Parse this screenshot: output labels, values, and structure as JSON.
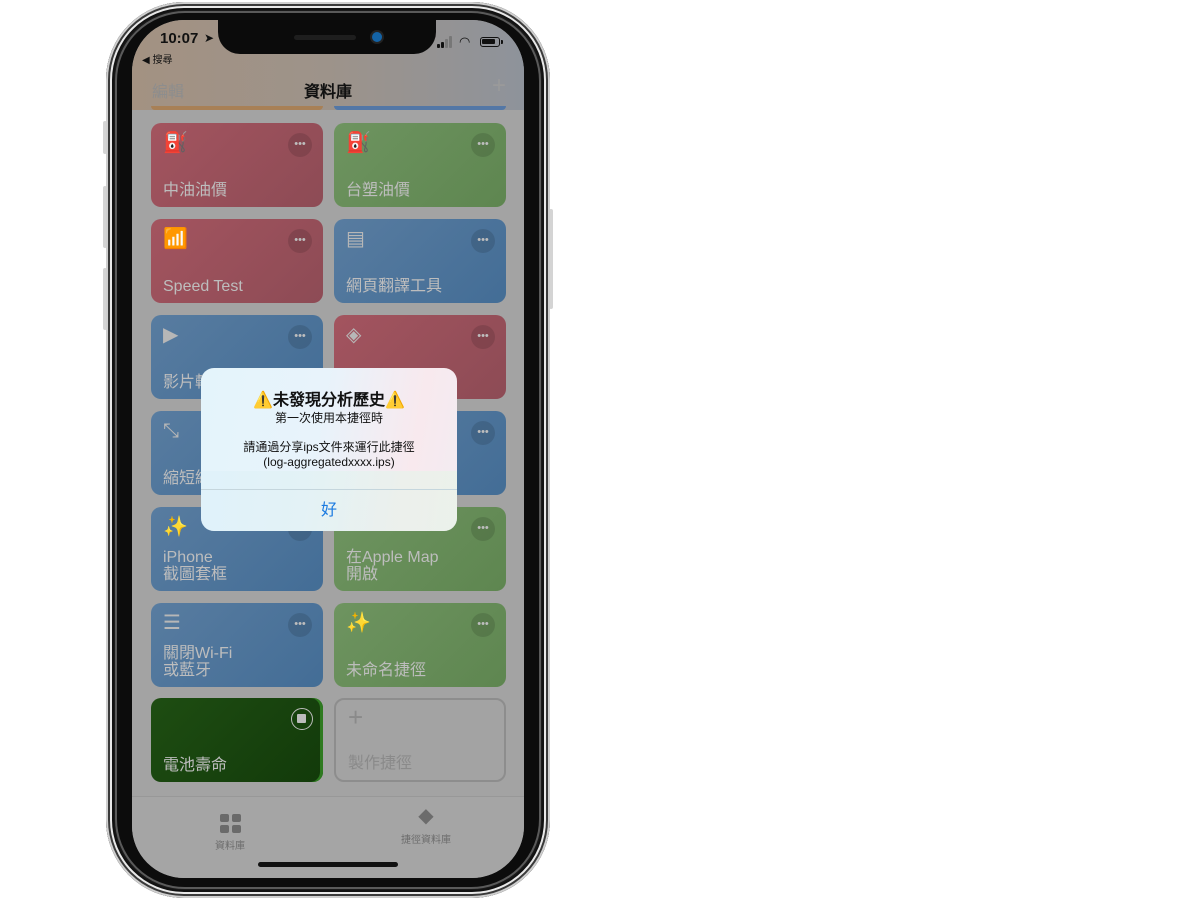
{
  "status_bar": {
    "time": "10:07",
    "back_app": "◀ 搜尋",
    "location_icon": "location-arrow-icon",
    "wifi_icon": "wifi-icon",
    "battery_icon": "battery-icon"
  },
  "nav": {
    "edit": "編輯",
    "title": "資料庫",
    "add": "+"
  },
  "tiles": [
    {
      "label": "中油油價",
      "icon": "⛽",
      "icon_name": "fuel-pump-icon",
      "color": "red"
    },
    {
      "label": "台塑油價",
      "icon": "⛽",
      "icon_name": "fuel-pump-icon",
      "color": "green"
    },
    {
      "label": "Speed Test",
      "icon": "📶",
      "icon_name": "wifi-icon",
      "color": "red"
    },
    {
      "label": "網頁翻譯工具",
      "icon": "▤",
      "icon_name": "document-icon",
      "color": "blue"
    },
    {
      "label": "影片轉",
      "icon": "▶",
      "icon_name": "video-clapper-icon",
      "color": "blue"
    },
    {
      "label": "",
      "icon": "◈",
      "icon_name": "compass-icon",
      "color": "red"
    },
    {
      "label": "縮短網",
      "icon": "⤡",
      "icon_name": "compress-arrows-icon",
      "color": "blue"
    },
    {
      "label": "",
      "icon": "",
      "icon_name": "",
      "color": "blue"
    },
    {
      "label": "iPhone\n截圖套框",
      "icon": "✨",
      "icon_name": "magic-wand-icon",
      "color": "blue"
    },
    {
      "label": "在Apple Map\n開啟",
      "icon": "",
      "icon_name": "map-pin-icon",
      "color": "green"
    },
    {
      "label": "關閉Wi-Fi\n或藍牙",
      "icon": "☰",
      "icon_name": "sliders-icon",
      "color": "blue"
    },
    {
      "label": "未命名捷徑",
      "icon": "✨",
      "icon_name": "magic-wand-icon",
      "color": "green"
    },
    {
      "label": "電池壽命",
      "icon": "",
      "icon_name": "",
      "color": "darkgreen",
      "running": true
    },
    {
      "label": "製作捷徑",
      "icon": "+",
      "icon_name": "plus-icon",
      "color": "add"
    }
  ],
  "more_glyph": "•••",
  "tabbar": [
    {
      "label": "資料庫",
      "icon_name": "grid-icon"
    },
    {
      "label": "捷徑資料庫",
      "icon_name": "layers-icon"
    }
  ],
  "alert": {
    "title": "⚠️未發現分析歷史⚠️",
    "subtitle": "第一次使用本捷徑時",
    "message_line1": "請通過分享ips文件來運行此捷徑",
    "message_line2": "(log-aggregatedxxxx.ips)",
    "ok": "好"
  }
}
